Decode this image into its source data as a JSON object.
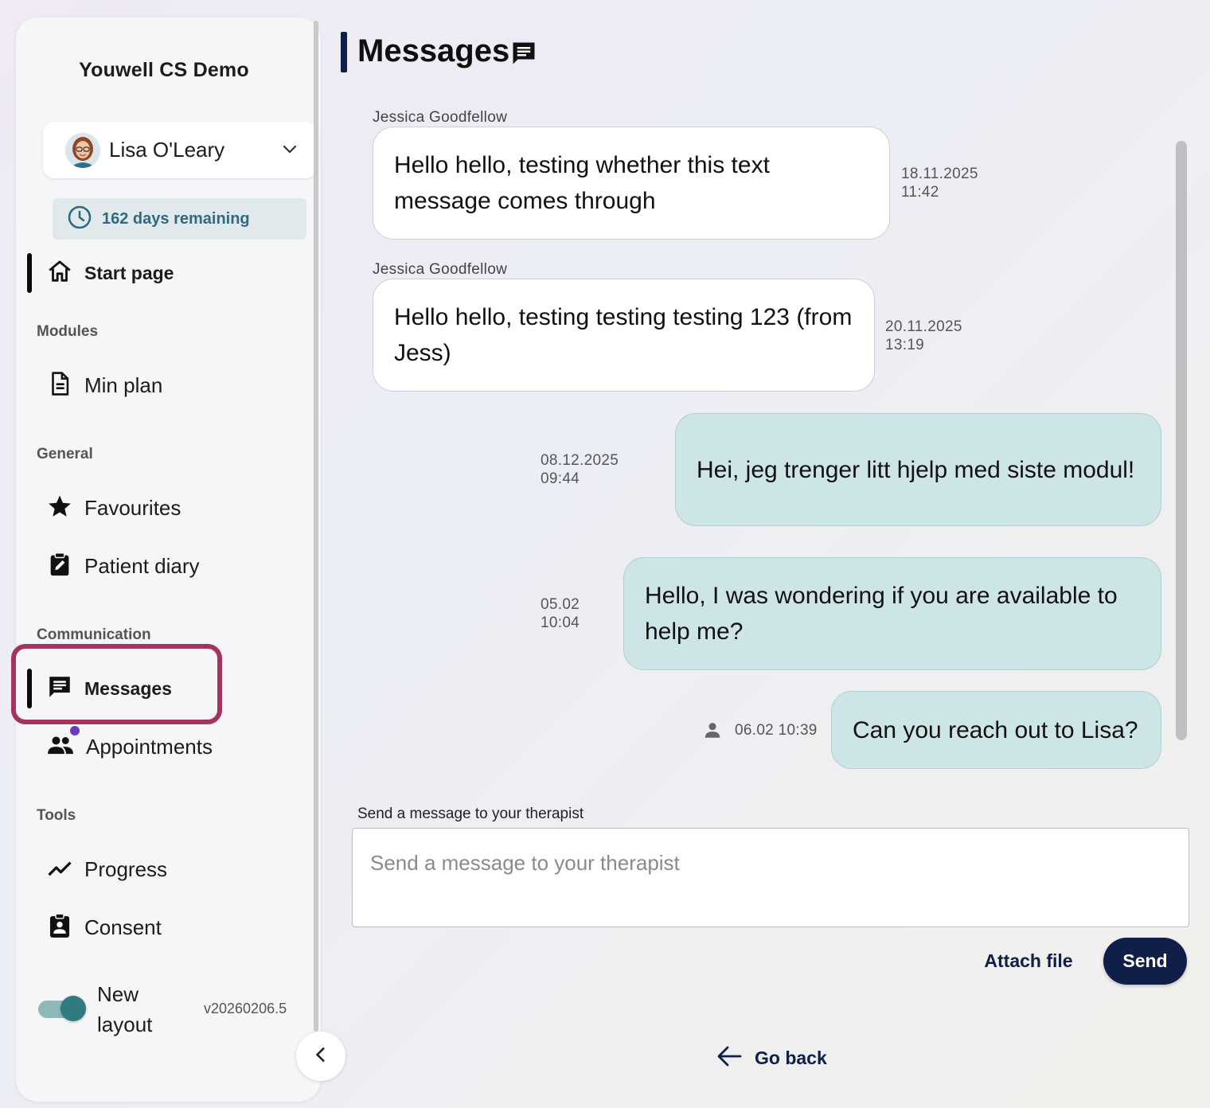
{
  "app": {
    "title": "Youwell CS Demo"
  },
  "user": {
    "name": "Lisa O'Leary",
    "days_remaining": "162 days remaining"
  },
  "nav": {
    "start_page": "Start page",
    "sections": {
      "modules": "Modules",
      "general": "General",
      "communication": "Communication",
      "tools": "Tools"
    },
    "items": {
      "min_plan": "Min plan",
      "favourites": "Favourites",
      "patient_diary": "Patient diary",
      "messages": "Messages",
      "appointments": "Appointments",
      "progress": "Progress",
      "consent": "Consent"
    },
    "active": "Messages"
  },
  "layout_toggle": {
    "label": "New layout",
    "on": true
  },
  "version": "v20260206.5",
  "page": {
    "title": "Messages"
  },
  "messages": [
    {
      "direction": "in",
      "sender": "Jessica Goodfellow",
      "text": "Hello hello, testing whether this text message comes through",
      "date": "18.11.2025",
      "time": "11:42"
    },
    {
      "direction": "in",
      "sender": "Jessica Goodfellow",
      "text": "Hello hello, testing testing testing 123 (from Jess)",
      "date": "20.11.2025",
      "time": "13:19"
    },
    {
      "direction": "out",
      "text": "Hei, jeg trenger litt hjelp med siste modul!",
      "date": "08.12.2025",
      "time": "09:44"
    },
    {
      "direction": "out",
      "text": "Hello, I was wondering if you are available to help me?",
      "date": "05.02",
      "time": "10:04"
    },
    {
      "direction": "out",
      "text": "Can you reach out to Lisa?",
      "timestamp": "06.02 10:39",
      "icon": "person-icon"
    }
  ],
  "compose": {
    "label": "Send a message to your therapist",
    "placeholder": "Send a message to your therapist",
    "value": "",
    "attach_label": "Attach file",
    "send_label": "Send"
  },
  "go_back": "Go back",
  "colors": {
    "primary": "#0f1f4a",
    "outgoing_bubble": "#cde5e6",
    "highlight": "#a3345f",
    "toggle": "#2f7b7d",
    "badge_text": "#2f6a80",
    "notification_dot": "#6a3bbf"
  }
}
